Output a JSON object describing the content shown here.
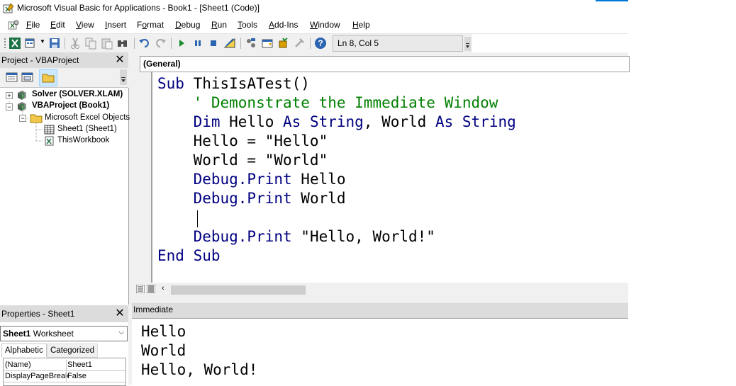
{
  "window": {
    "title": "Microsoft Visual Basic for Applications - Book1 - [Sheet1 (Code)]"
  },
  "menu": {
    "items": [
      {
        "label": "File",
        "key": "F"
      },
      {
        "label": "Edit",
        "key": "E"
      },
      {
        "label": "View",
        "key": "V"
      },
      {
        "label": "Insert",
        "key": "I"
      },
      {
        "label": "Format",
        "key": "o"
      },
      {
        "label": "Debug",
        "key": "D"
      },
      {
        "label": "Run",
        "key": "R"
      },
      {
        "label": "Tools",
        "key": "T"
      },
      {
        "label": "Add-Ins",
        "key": "A"
      },
      {
        "label": "Window",
        "key": "W"
      },
      {
        "label": "Help",
        "key": "H"
      }
    ]
  },
  "toolbar": {
    "position": "Ln 8, Col 5",
    "icons": [
      "view-excel-icon",
      "insert-module-icon",
      "save-icon",
      "cut-icon",
      "copy-icon",
      "paste-icon",
      "find-icon",
      "undo-icon",
      "redo-icon",
      "run-icon",
      "break-icon",
      "reset-icon",
      "design-mode-icon",
      "project-explorer-icon",
      "properties-icon",
      "object-browser-icon",
      "toolbox-icon",
      "help-icon"
    ]
  },
  "project": {
    "title": "Project - VBAProject",
    "tree": [
      {
        "label": "Solver (SOLVER.XLAM)",
        "bold": true,
        "expander": "+"
      },
      {
        "label": "VBAProject (Book1)",
        "bold": true,
        "expander": "−"
      },
      {
        "label": "Microsoft Excel Objects",
        "bold": false,
        "expander": "−"
      },
      {
        "label": "Sheet1 (Sheet1)",
        "bold": false
      },
      {
        "label": "ThisWorkbook",
        "bold": false
      }
    ]
  },
  "properties": {
    "title": "Properties - Sheet1",
    "object_name": "Sheet1",
    "object_type": "Worksheet",
    "tabs": [
      "Alphabetic",
      "Categorized"
    ],
    "rows": [
      {
        "name": "(Name)",
        "value": "Sheet1"
      },
      {
        "name": "DisplayPageBreak",
        "value": "False"
      }
    ]
  },
  "code": {
    "object_combo": "(General)",
    "lines": [
      [
        {
          "t": "Sub ",
          "c": "kw"
        },
        {
          "t": "ThisIsATest()",
          "c": ""
        }
      ],
      [
        {
          "t": "    ",
          "c": ""
        },
        {
          "t": "' Demonstrate the Immediate Window",
          "c": "cm"
        }
      ],
      [
        {
          "t": "    ",
          "c": ""
        },
        {
          "t": "Dim ",
          "c": "kw"
        },
        {
          "t": "Hello ",
          "c": ""
        },
        {
          "t": "As String",
          "c": "kw"
        },
        {
          "t": ", World ",
          "c": ""
        },
        {
          "t": "As String",
          "c": "kw"
        }
      ],
      [
        {
          "t": "    Hello = \"Hello\"",
          "c": ""
        }
      ],
      [
        {
          "t": "    World = \"World\"",
          "c": ""
        }
      ],
      [
        {
          "t": "    ",
          "c": ""
        },
        {
          "t": "Debug.Print",
          "c": "kw"
        },
        {
          "t": " Hello",
          "c": ""
        }
      ],
      [
        {
          "t": "    ",
          "c": ""
        },
        {
          "t": "Debug.Print",
          "c": "kw"
        },
        {
          "t": " World",
          "c": ""
        }
      ],
      [
        {
          "t": "",
          "c": ""
        }
      ],
      [
        {
          "t": "    ",
          "c": ""
        },
        {
          "t": "Debug.Print",
          "c": "kw"
        },
        {
          "t": " \"Hello, World!\"",
          "c": ""
        }
      ],
      [
        {
          "t": "End Sub",
          "c": "kw"
        }
      ]
    ]
  },
  "immediate": {
    "title": "Immediate",
    "lines": [
      "Hello",
      "World",
      "Hello, World!"
    ]
  }
}
